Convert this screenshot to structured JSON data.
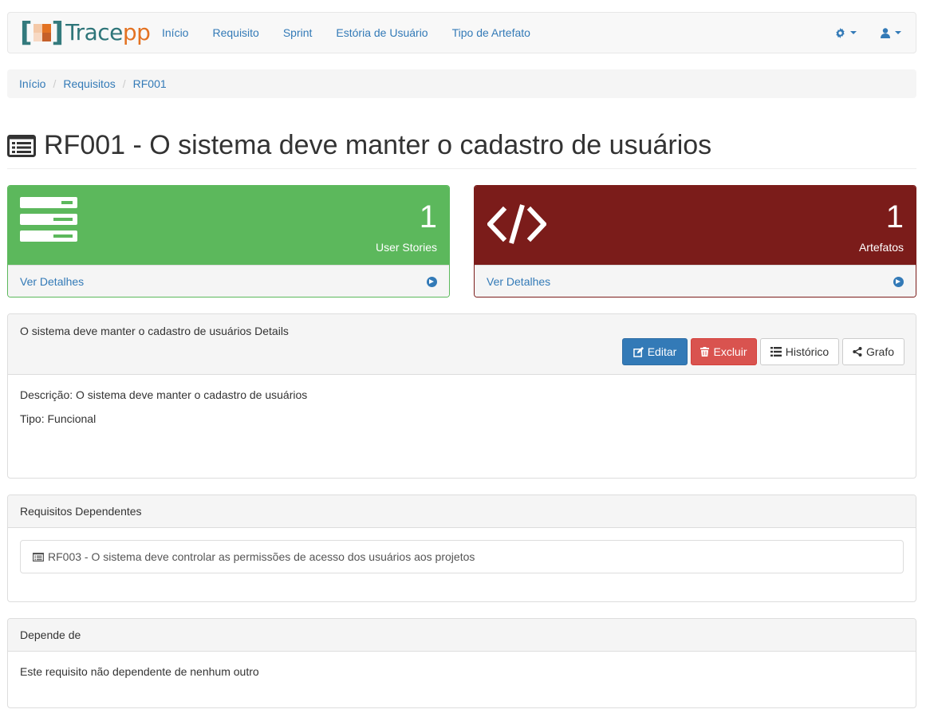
{
  "brand": {
    "bracket_open": "[",
    "bracket_close": "]",
    "name_part1": "Trace",
    "name_part2": "pp"
  },
  "nav": {
    "links": [
      "Início",
      "Requisito",
      "Sprint",
      "Estória de Usuário",
      "Tipo de Artefato"
    ],
    "settings_icon": "gear-icon",
    "user_icon": "user-icon"
  },
  "breadcrumb": [
    "Início",
    "Requisitos",
    "RF001"
  ],
  "page": {
    "title": "RF001 - O sistema deve manter o cadastro de usuários",
    "title_icon": "list-alt-icon"
  },
  "stats": [
    {
      "count": "1",
      "label": "User Stories",
      "link": "Ver Detalhes",
      "color": "#5cb85c",
      "icon": "server-icon"
    },
    {
      "count": "1",
      "label": "Artefatos",
      "link": "Ver Detalhes",
      "color": "#7b1c1a",
      "icon": "code-icon"
    }
  ],
  "details": {
    "heading": "O sistema deve manter o cadastro de usuários Details",
    "buttons": {
      "edit": "Editar",
      "delete": "Excluir",
      "history": "Histórico",
      "graph": "Grafo"
    },
    "description": "Descrição: O sistema deve manter o cadastro de usuários",
    "type": "Tipo: Funcional"
  },
  "dependents": {
    "heading": "Requisitos Dependentes",
    "items": [
      "RF003 - O sistema deve controlar as permissões de acesso dos usuários aos projetos"
    ]
  },
  "depends_on": {
    "heading": "Depende de",
    "empty_text": "Este requisito não dependente de nenhum outro"
  },
  "colors": {
    "link": "#337ab7",
    "success": "#5cb85c",
    "danger_dark": "#7b1c1a",
    "primary": "#337ab7",
    "danger": "#d9534f"
  }
}
